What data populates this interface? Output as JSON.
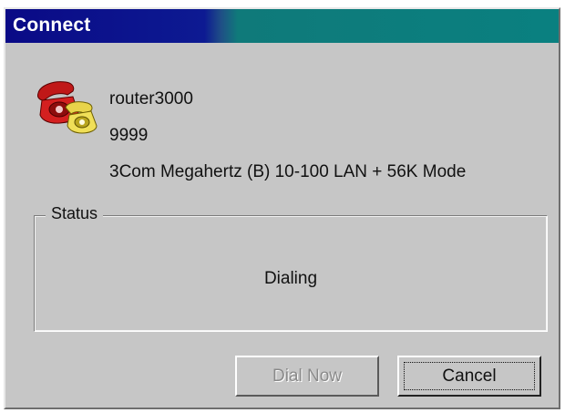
{
  "window": {
    "title": "Connect"
  },
  "connection": {
    "name": "router3000",
    "number": "9999",
    "device": "3Com Megahertz (B) 10-100 LAN + 56K Mode",
    "icon": "telephone-icon"
  },
  "status": {
    "group_label": "Status",
    "message": "Dialing"
  },
  "buttons": {
    "dial_now": "Dial Now",
    "cancel": "Cancel"
  },
  "colors": {
    "title_bar_left": "#0a0a86",
    "title_bar_right": "#0a8080",
    "dialog_face": "#c6c6c6"
  }
}
